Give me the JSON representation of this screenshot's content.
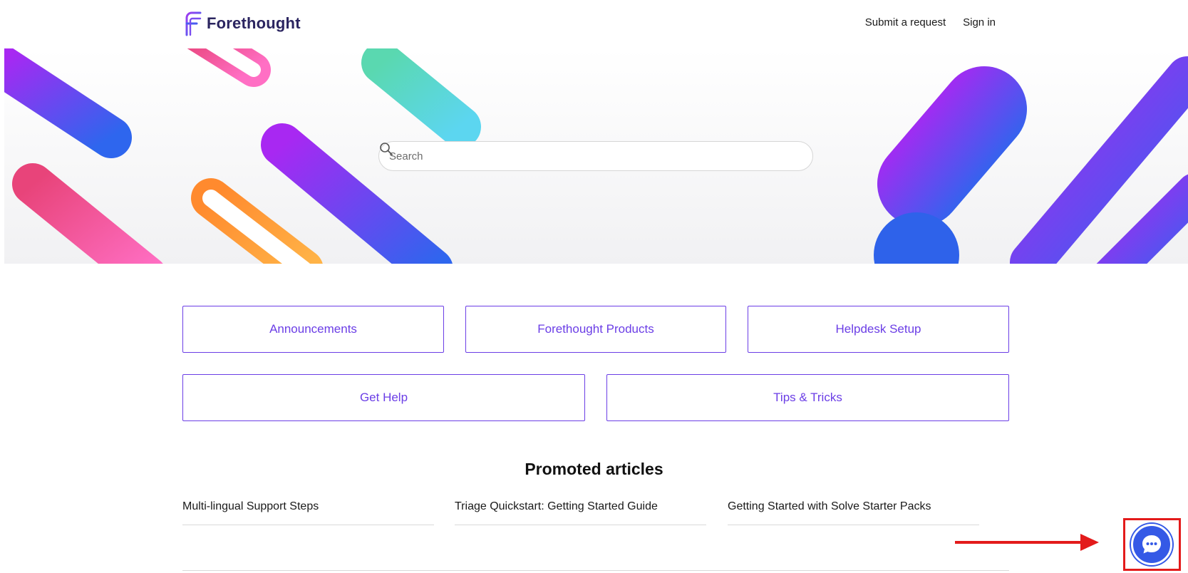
{
  "header": {
    "brand": "Forethought",
    "nav": [
      {
        "label": "Submit a request"
      },
      {
        "label": "Sign in"
      }
    ]
  },
  "hero": {
    "search": {
      "placeholder": "Search",
      "value": ""
    }
  },
  "categories": [
    {
      "label": "Announcements"
    },
    {
      "label": "Forethought Products"
    },
    {
      "label": "Helpdesk Setup"
    },
    {
      "label": "Get Help"
    },
    {
      "label": "Tips & Tricks"
    }
  ],
  "promoted": {
    "title": "Promoted articles",
    "articles": [
      {
        "title": "Multi-lingual Support Steps"
      },
      {
        "title": "Triage Quickstart: Getting Started Guide"
      },
      {
        "title": "Getting Started with Solve Starter Packs"
      }
    ]
  },
  "colors": {
    "accent": "#6b3ee6",
    "chat_button": "#3559e6",
    "annotation": "#e31b1b"
  },
  "icons": {
    "search": "search-icon",
    "chat": "chat-bubble-icon",
    "logo": "forethought-logo-icon"
  }
}
